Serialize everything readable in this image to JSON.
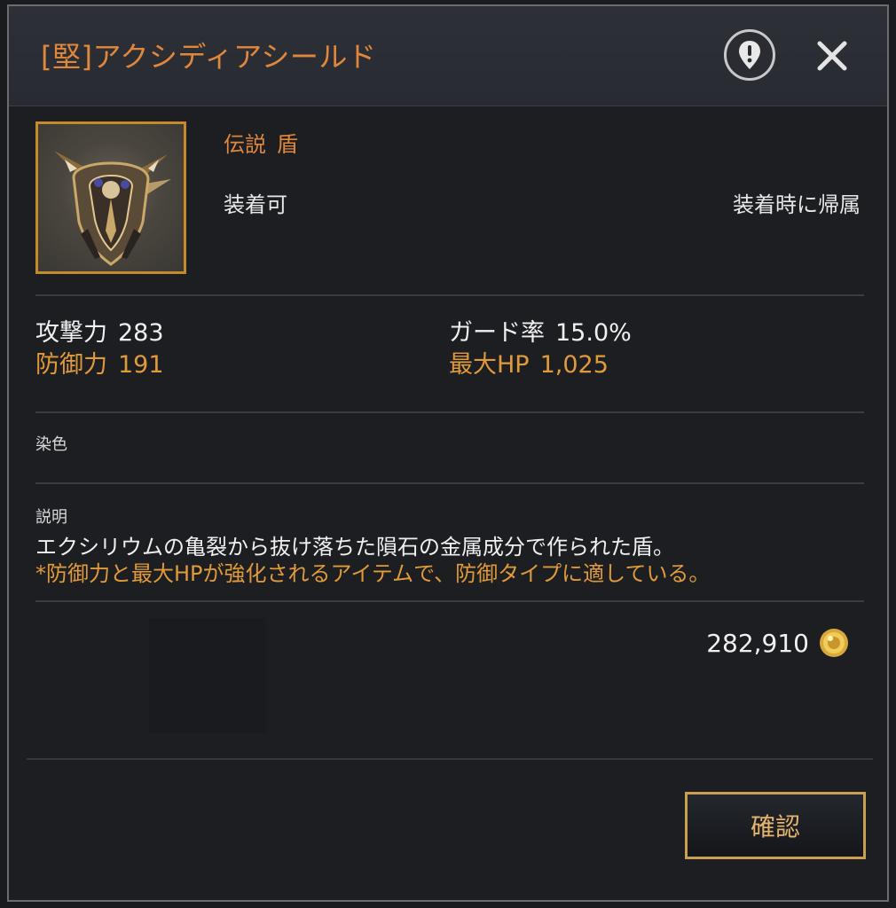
{
  "header": {
    "title": "[堅]アクシディアシールド",
    "alert_icon": "exclamation-pin-icon",
    "close_icon": "close-x-icon"
  },
  "item": {
    "grade": "伝説",
    "type": "盾",
    "equip_status": "装着可",
    "bind_text": "装着時に帰属",
    "image": "shield-item-icon",
    "frame_color": "#c78a2a"
  },
  "stats": [
    {
      "label": "攻撃力",
      "value": "283"
    },
    {
      "label": "ガード率",
      "value": "15.0%"
    },
    {
      "label": "防御力",
      "value": "191"
    },
    {
      "label": "最大HP",
      "value": "1,025"
    }
  ],
  "dye": {
    "label": "染色"
  },
  "description": {
    "label": "説明",
    "line1": "エクシリウムの亀裂から抜け落ちた隕石の金属成分で作られた盾。",
    "line2": "*防御力と最大HPが強化されるアイテムで、防御タイプに適している。"
  },
  "price": {
    "value": "282,910",
    "icon": "gold-coin-icon"
  },
  "footer": {
    "confirm_label": "確認"
  },
  "colors": {
    "accent": "#e0873c",
    "highlight": "#e09a3a",
    "button_border": "#c9a050"
  }
}
